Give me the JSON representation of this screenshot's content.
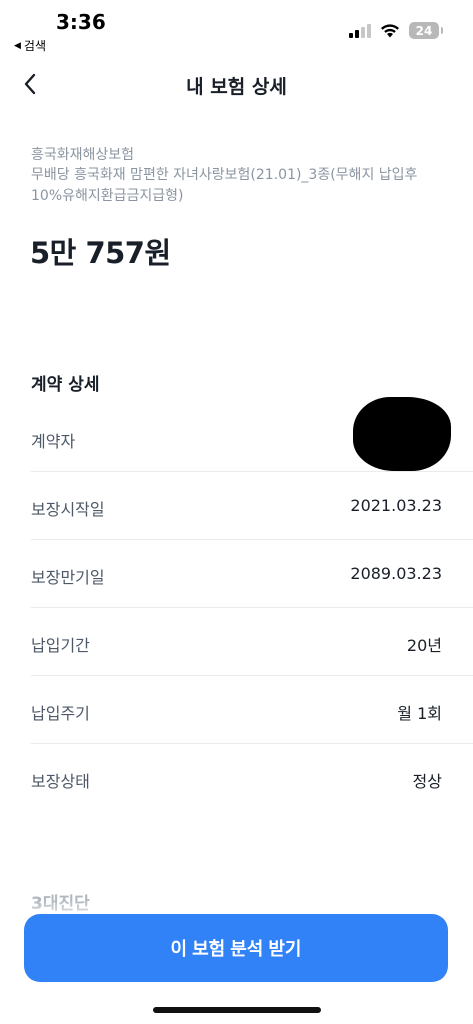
{
  "status_bar": {
    "time": "3:36",
    "back_app_label": "검색",
    "battery_level": "24"
  },
  "header": {
    "title": "내 보험 상세"
  },
  "insurance": {
    "company": "흥국화재해상보험",
    "product_name": "무배당 흥국화재 맘편한 자녀사랑보험(21.01)_3종(무해지 납입후 10%유해지환급금지급형)",
    "premium": "5만 757원"
  },
  "contract": {
    "section_title": "계약 상세",
    "rows": [
      {
        "label": "계약자",
        "value": ""
      },
      {
        "label": "보장시작일",
        "value": "2021.03.23"
      },
      {
        "label": "보장만기일",
        "value": "2089.03.23"
      },
      {
        "label": "납입기간",
        "value": "20년"
      },
      {
        "label": "납입주기",
        "value": "월 1회"
      },
      {
        "label": "보장상태",
        "value": "정상"
      }
    ]
  },
  "next_section_title": "3대진단",
  "cta": {
    "label": "이 보험 분석 받기"
  },
  "colors": {
    "primary": "#3182f6",
    "text_primary": "#191f28",
    "text_secondary": "#8b95a1",
    "divider": "#e9ebee"
  }
}
